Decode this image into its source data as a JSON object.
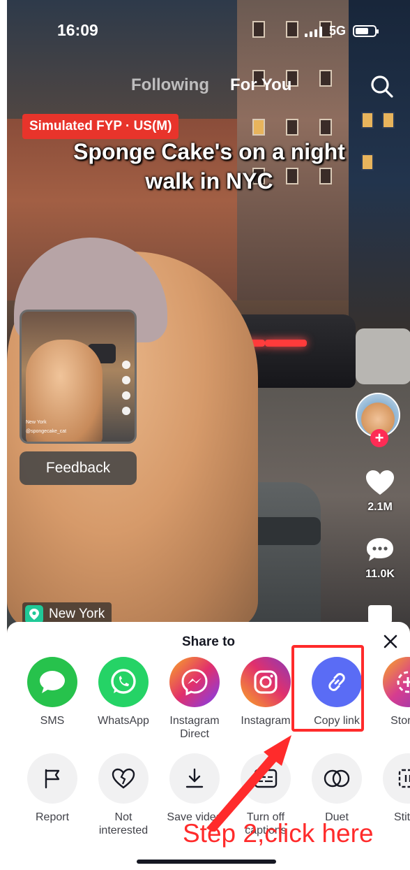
{
  "status_bar": {
    "time": "16:09",
    "network": "5G"
  },
  "nav": {
    "tabs": [
      {
        "label": "Following"
      },
      {
        "label": "For You"
      }
    ]
  },
  "badge": "Simulated FYP · US(M)",
  "video": {
    "caption": "Sponge Cake's on a night walk in NYC",
    "location": "New York",
    "preview_location": "New York",
    "preview_user": "@spongecake_cat"
  },
  "feedback_label": "Feedback",
  "rail": {
    "likes": "2.1M",
    "comments": "11.0K"
  },
  "share_sheet": {
    "title": "Share to",
    "share_targets": [
      {
        "label": "SMS",
        "icon": "sms-bubble-icon",
        "color": "#27c24c"
      },
      {
        "label": "WhatsApp",
        "icon": "whatsapp-icon",
        "color": "#25d366"
      },
      {
        "label": "Instagram Direct",
        "icon": "messenger-icon",
        "color": "#a33ee6"
      },
      {
        "label": "Instagram",
        "icon": "instagram-icon",
        "color": "#e1306c"
      },
      {
        "label": "Copy link",
        "icon": "link-icon",
        "color": "#5a6cf5"
      },
      {
        "label": "Stories",
        "icon": "stories-plus-icon",
        "color": "#d63c8f"
      }
    ],
    "actions": [
      {
        "label": "Report",
        "icon": "flag-icon"
      },
      {
        "label": "Not interested",
        "icon": "broken-heart-icon"
      },
      {
        "label": "Save video",
        "icon": "download-icon"
      },
      {
        "label": "Turn off captions",
        "icon": "captions-icon"
      },
      {
        "label": "Duet",
        "icon": "duet-icon"
      },
      {
        "label": "Stitch",
        "icon": "stitch-icon"
      }
    ]
  },
  "annotation": {
    "step_text": "Step 2,click here",
    "color": "#ff2b2b"
  }
}
